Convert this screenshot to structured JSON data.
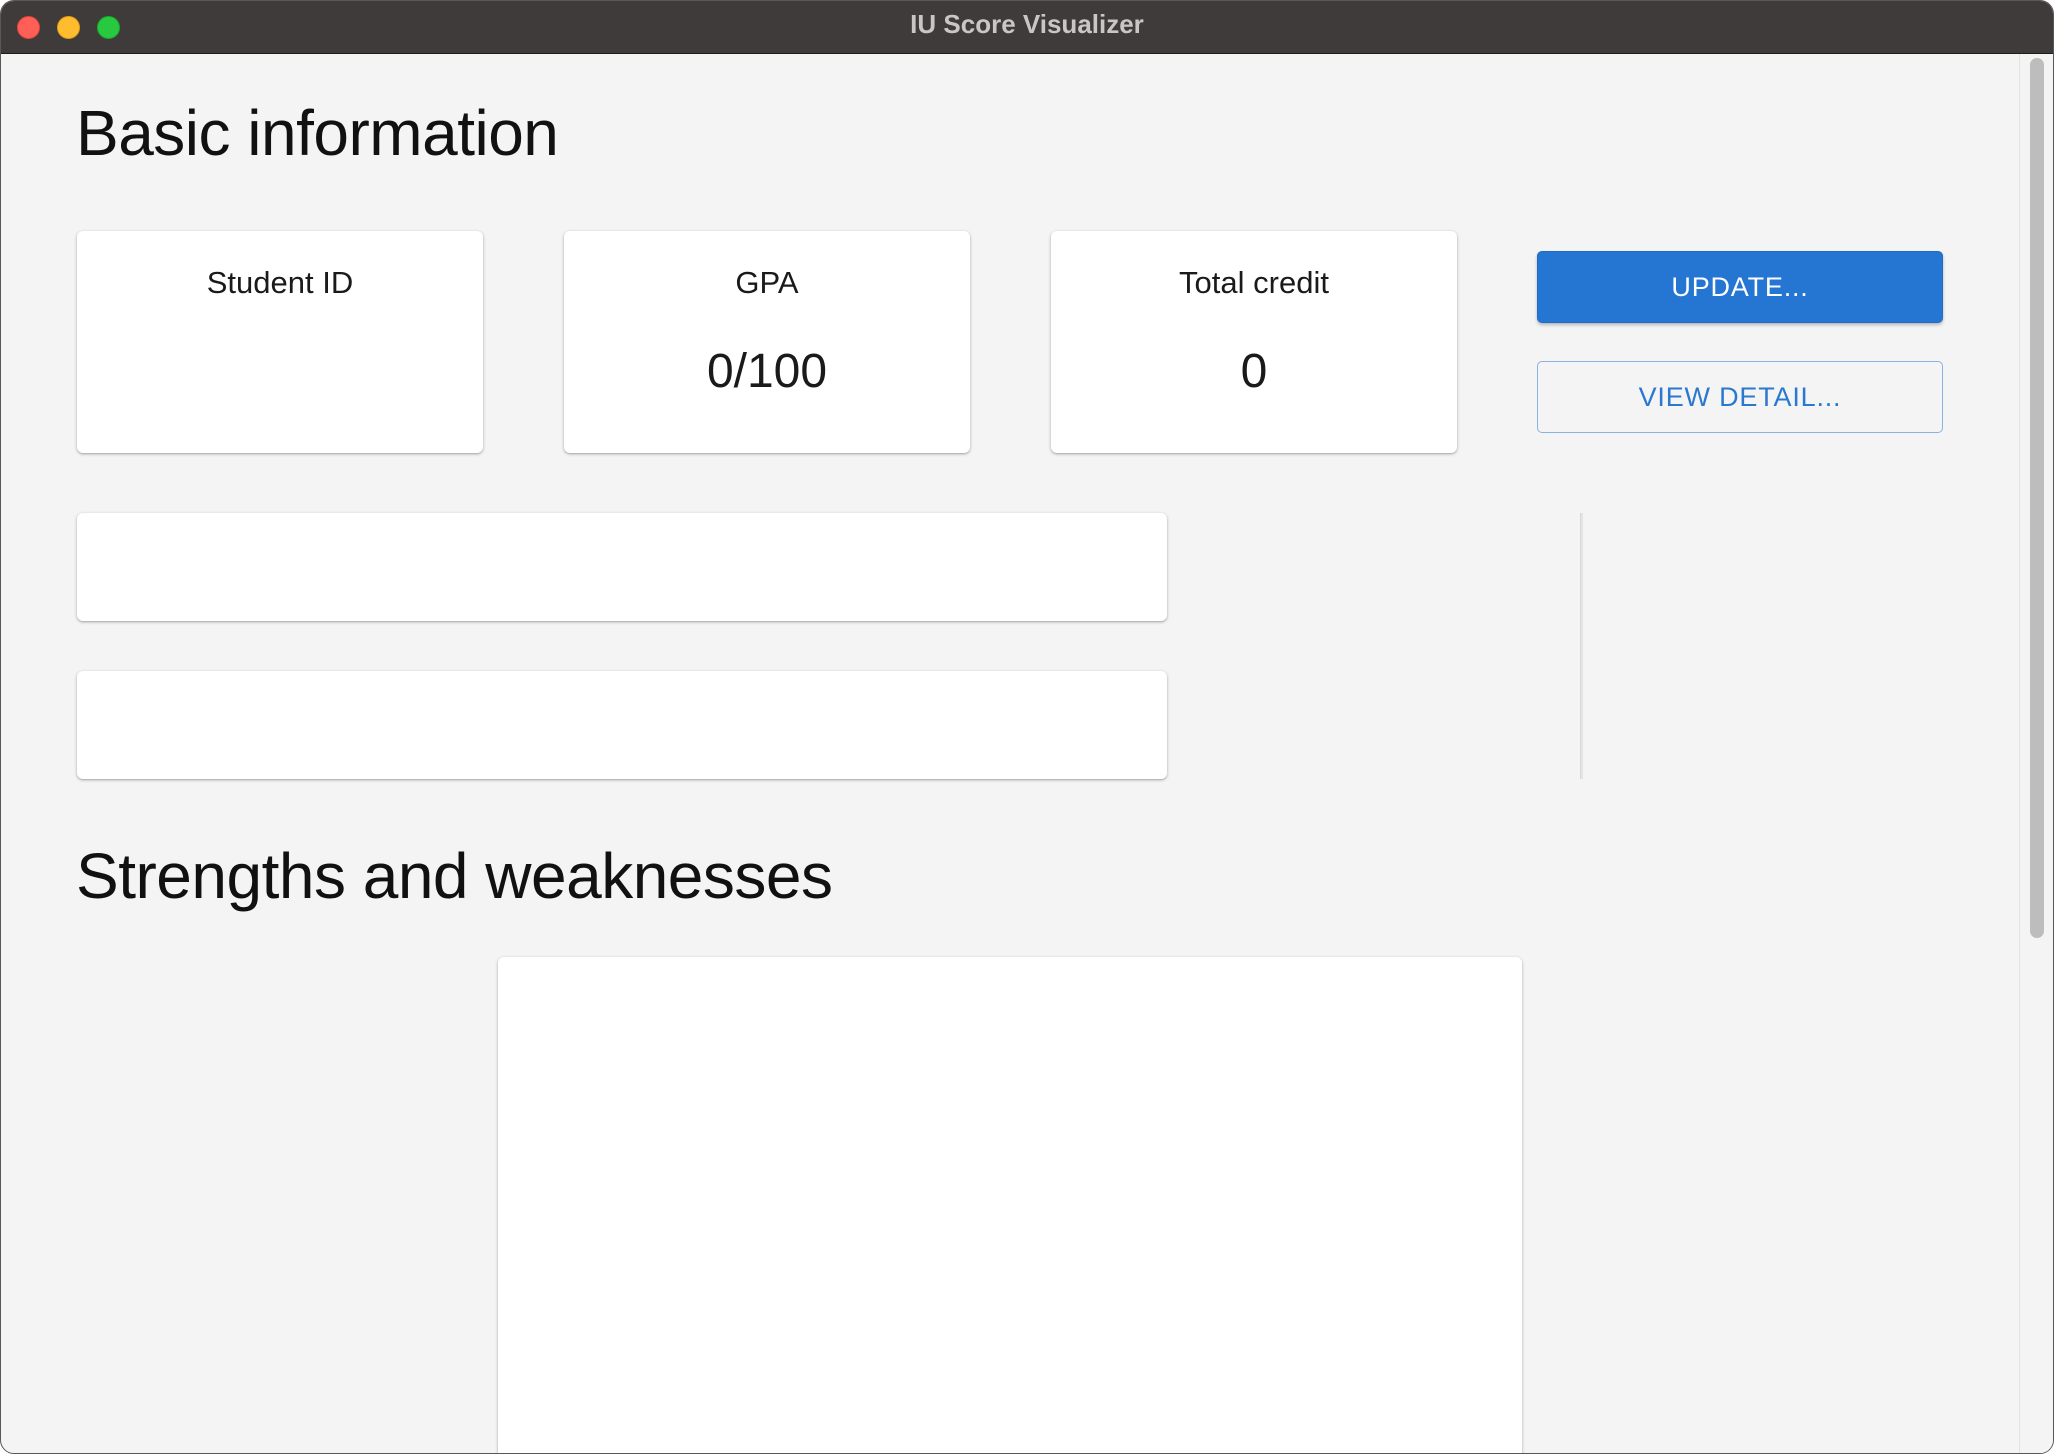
{
  "window": {
    "title": "IU Score Visualizer"
  },
  "basic_info": {
    "heading": "Basic information",
    "cards": [
      {
        "label": "Student ID",
        "value": ""
      },
      {
        "label": "GPA",
        "value": "0/100"
      },
      {
        "label": "Total credit",
        "value": "0"
      }
    ],
    "update_label": "UPDATE...",
    "view_detail_label": "VIEW DETAIL..."
  },
  "strengths": {
    "heading": "Strengths and weaknesses"
  },
  "colors": {
    "primary": "#2476d2",
    "background": "#f4f4f4",
    "titlebar": "#3f3b3a"
  }
}
